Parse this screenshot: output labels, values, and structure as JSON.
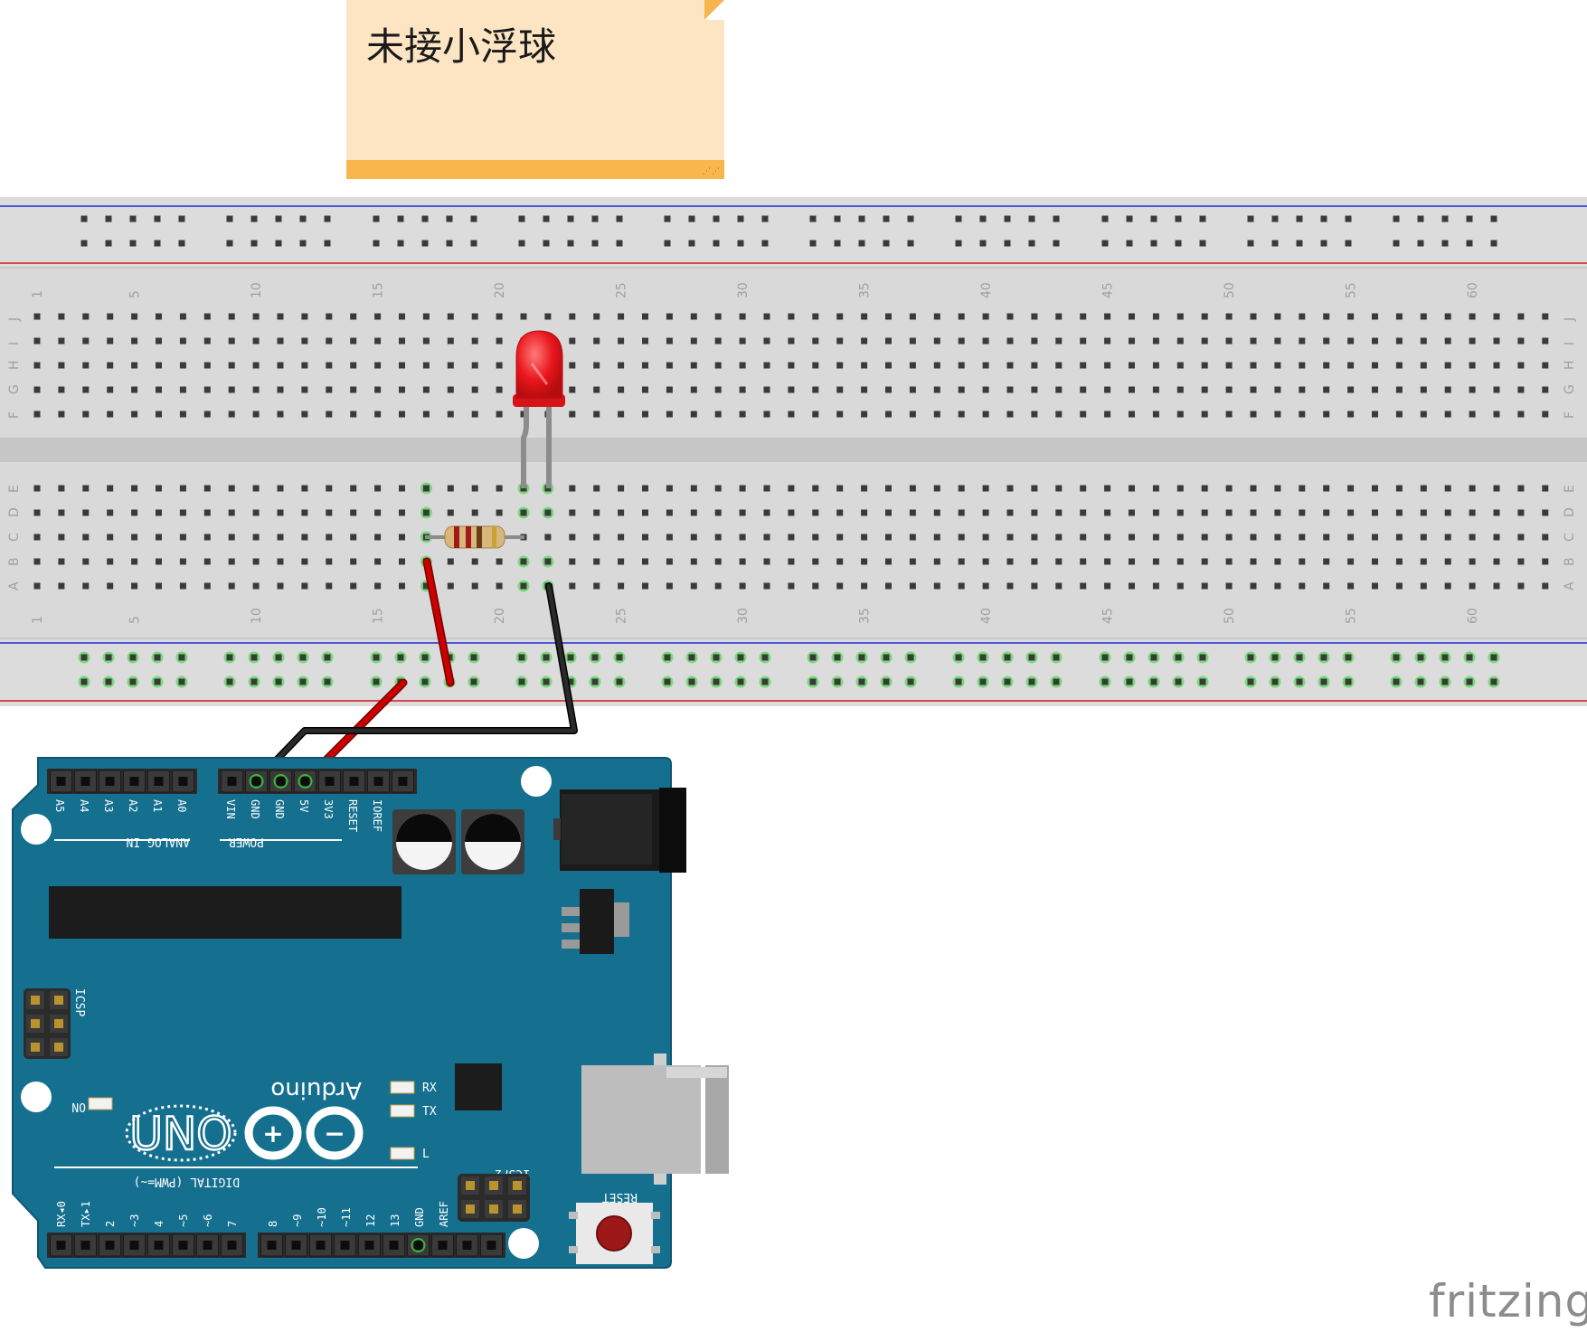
{
  "note": {
    "text": "未接小浮球"
  },
  "watermark": "fritzing",
  "breadboard": {
    "column_numbers": [
      "1",
      "5",
      "10",
      "15",
      "20",
      "25",
      "30",
      "35",
      "40",
      "45",
      "50",
      "55",
      "60"
    ],
    "row_letters_top": [
      "J",
      "I",
      "H",
      "G",
      "F"
    ],
    "row_letters_bottom": [
      "E",
      "D",
      "C",
      "B",
      "A"
    ]
  },
  "arduino": {
    "board_name": "Arduino",
    "model": "UNO",
    "analog_label": "ANALOG IN",
    "power_label": "POWER",
    "digital_label": "DIGITAL (PWM=~)",
    "analog_pins": [
      "A5",
      "A4",
      "A3",
      "A2",
      "A1",
      "A0"
    ],
    "power_pins": [
      "VIN",
      "GND",
      "GND",
      "5V",
      "3V3",
      "RESET",
      "IOREF"
    ],
    "digital_pins_right": [
      "AREF",
      "GND",
      "13",
      "12",
      "~11",
      "~10",
      "~9",
      "8"
    ],
    "digital_pins_left": [
      "7",
      "~6",
      "~5",
      "4",
      "~3",
      "2",
      "TX▸1",
      "RX◂0"
    ],
    "leds": [
      "RX",
      "TX",
      "L",
      "ON"
    ],
    "icsp": "ICSP",
    "icsp2": "ICSP2",
    "reset": "RESET"
  },
  "colors": {
    "board": "#156f8f",
    "breadboard": "#d9d9d9",
    "wire_red": "#c80000",
    "wire_black": "#222222",
    "led": "#e8161b",
    "note_bg": "#fde5c3",
    "note_bar": "#f8b64d"
  }
}
